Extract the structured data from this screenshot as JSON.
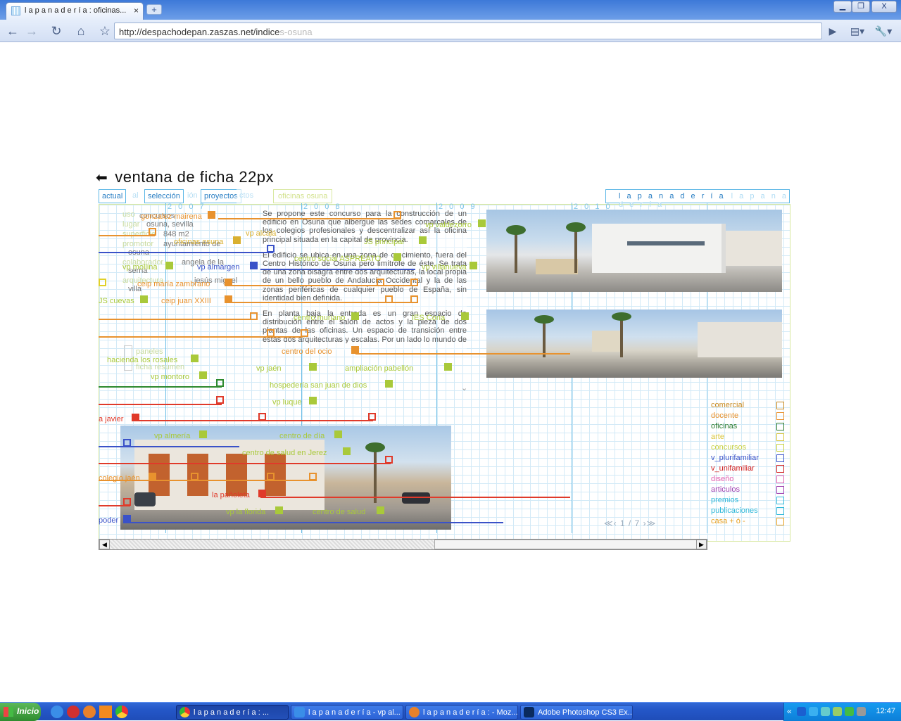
{
  "browser": {
    "tab_title": "l a p a n a d e r í a : oficinas...",
    "tab_close": "×",
    "new_tab": "+",
    "window_buttons": [
      "▁",
      "❐",
      "X"
    ],
    "url_text": "http://despachodepan.zaszas.net/indice",
    "url_ghost": "s-osuna",
    "nav_icons": [
      "back-icon",
      "forward-icon",
      "reload-icon",
      "home-icon",
      "bookmark-star-icon",
      "go-icon",
      "page-menu-icon",
      "wrench-icon"
    ]
  },
  "page": {
    "heading": "ventana de ficha 22px",
    "nav_tabs": [
      "actual",
      "selección",
      "proyectos"
    ],
    "nav_tabs_ghost": [
      "al",
      "ión",
      "ctos",
      "ñs"
    ],
    "oficinas_tag": "oficinas osuna",
    "brand": "l a p a n a d e r í a",
    "brand_ghost": "l a p a n a d e r í a",
    "years": [
      "2 0 0 7",
      "2 0 0 8",
      "2 0 0 9",
      "2 0 1 0"
    ],
    "fields": [
      "uso",
      "lugar",
      "superficie",
      "promotor",
      "",
      "colaborador",
      "",
      "arquitectura",
      ""
    ],
    "field_values": [
      "concursos",
      "osuna, sevilla",
      "848 m2",
      "ayuntamiento de",
      "osuna",
      "angela de la",
      "serna",
      "jesús miguel",
      "villa"
    ],
    "aside": [
      "paneles",
      "ficha resumen"
    ],
    "article": [
      "Se propone este concurso para la construcción de un edificio en Osuna que albergue las sedes comarcales de los colegios profesionales y descentralizar así la oficina principal situada en la capital de provincia.",
      "El edificio se ubica en una zona de crecimiento, fuera del Centro Histórico de Osuna pero limítrofe de éste. Se trata de una zona bisagra entre dos arquitecturas, la local propia de un bello pueblo de Andalucía Occidental y la de las zonas periféricas de cualquier pueblo de España, sin identidad bien definida.",
      "En planta baja la entrada es un gran espacio de distribución entre el salón de actos y la pieza de dos plantas de las oficinas. Un espacio de transición entre estas dos arquitecturas y escalas. Por un lado lo mundo de las oficinas y el movimiento diario de personas y por otro un gran"
    ],
    "projects": [
      {
        "label": "gonzalez mairena",
        "color": "#e8922e"
      },
      {
        "label": "vp valdezorro",
        "color": "#a9c93a"
      },
      {
        "label": "vp alcalá",
        "color": "#d9b030"
      },
      {
        "label": "oficinas osuna",
        "color": "#d9b030"
      },
      {
        "label": "JS principal",
        "color": "#a9c93a"
      },
      {
        "label": "centro social ASPREATO",
        "color": "#a9c93a"
      },
      {
        "label": "vp mollina",
        "color": "#a9c93a"
      },
      {
        "label": "vp almargen",
        "color": "#3a52c8"
      },
      {
        "label": "vp villanueva",
        "color": "#a9c93a"
      },
      {
        "label": "ceip maría zambrano",
        "color": "#e8922e"
      },
      {
        "label": "JS cuevas",
        "color": "#a9c93a"
      },
      {
        "label": "ceip juan XXIII",
        "color": "#e8922e"
      },
      {
        "label": "centro muriano",
        "color": "#a9c93a"
      },
      {
        "label": "IES Coria",
        "color": "#a9c93a"
      },
      {
        "label": "centro del ocio",
        "color": "#e8922e"
      },
      {
        "label": "hacienda los rosales",
        "color": "#a9c93a"
      },
      {
        "label": "vp montoro",
        "color": "#a9c93a"
      },
      {
        "label": "vp jaén",
        "color": "#a9c93a"
      },
      {
        "label": "ampliación pabellón",
        "color": "#a9c93a"
      },
      {
        "label": "hospedería san juan de dios",
        "color": "#a9c93a"
      },
      {
        "label": "vp luque",
        "color": "#a9c93a"
      },
      {
        "label": "a javier",
        "color": "#e03a2a"
      },
      {
        "label": "vp almería",
        "color": "#a9c93a"
      },
      {
        "label": "centro de día",
        "color": "#a9c93a"
      },
      {
        "label": "centro de salud en Jerez",
        "color": "#a9c93a"
      },
      {
        "label": "colegio jaén",
        "color": "#e8922e"
      },
      {
        "label": "la pañoleta",
        "color": "#e03a2a"
      },
      {
        "label": "vp la florida",
        "color": "#a9c93a"
      },
      {
        "label": "centro de salud",
        "color": "#a9c93a"
      },
      {
        "label": "poder",
        "color": "#3a52c8"
      }
    ],
    "legend": [
      {
        "label": "comercial",
        "color": "#c88a20"
      },
      {
        "label": "docente",
        "color": "#e8922e"
      },
      {
        "label": "oficinas",
        "color": "#2e7d32"
      },
      {
        "label": "arte",
        "color": "#d9c53a"
      },
      {
        "label": "concursos",
        "color": "#c8d040"
      },
      {
        "label": "v_plurifamiliar",
        "color": "#3a52c8"
      },
      {
        "label": "v_unifamiliar",
        "color": "#d02020"
      },
      {
        "label": "diseño",
        "color": "#e060b0"
      },
      {
        "label": "articulos",
        "color": "#a040b0"
      },
      {
        "label": "premios",
        "color": "#30b8d8"
      },
      {
        "label": "publicaciones",
        "color": "#30b8d8"
      },
      {
        "label": "casa + ó -",
        "color": "#e8a020"
      }
    ],
    "pager": "≪‹ 1 / 7 ›≫"
  },
  "taskbar": {
    "start": "Inicio",
    "tasks": [
      "l a p a n a d e r í a : ...",
      "l a p a n a d e r í a - vp al...",
      "l a p a n a d e r í a : - Moz...",
      "Adobe Photoshop CS3 Ex..."
    ],
    "clock": "12:47",
    "tray_collapse": "«"
  }
}
